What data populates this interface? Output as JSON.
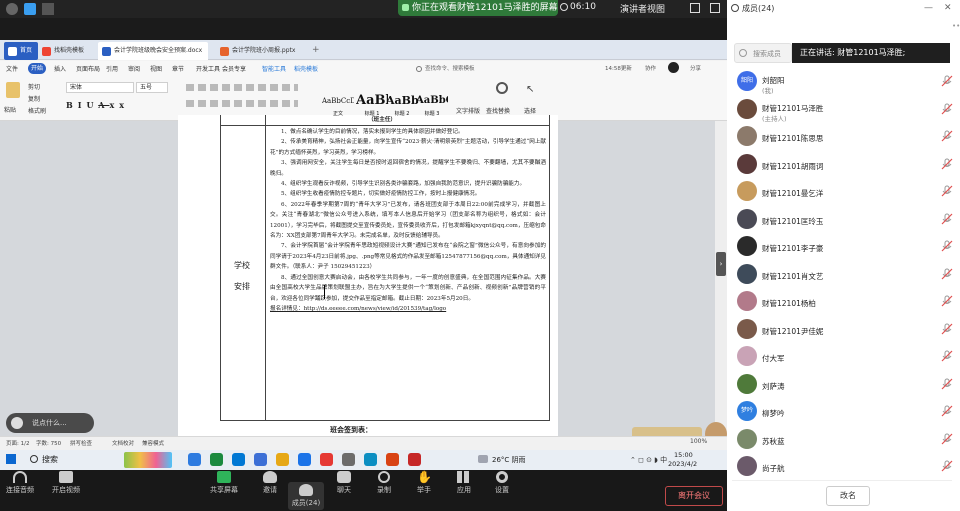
{
  "meeting": {
    "share_banner": "你正在观看财管12101马泽胜的屏幕",
    "timer": "06:10",
    "view_mode": "演讲者视图",
    "participants_title": "成员(24)",
    "search_placeholder": "搜索成员",
    "speaking_label": "正在讲话: 财管12101马泽胜;",
    "toolbar": {
      "audio": "连接音频",
      "video": "开启视频",
      "share": "共享屏幕",
      "invite": "邀请",
      "members": "成员(24)",
      "chat": "聊天",
      "record": "录制",
      "raise_hand": "举手",
      "apps": "应用",
      "settings": "设置",
      "leave": "离开会议"
    },
    "mute_all": "改名",
    "chat_hint": "说点什么..."
  },
  "members": [
    {
      "name": "刘韶阳",
      "sub": "(我)",
      "avatar_text": "韶阳",
      "color": "#3f6ee8"
    },
    {
      "name": "财管12101马泽胜",
      "sub": "(主持人)",
      "avatar_text": "",
      "color": "#6a4b3c"
    },
    {
      "name": "财管12101陈思思",
      "sub": "",
      "avatar_text": "",
      "color": "#8c7a6b"
    },
    {
      "name": "财管12101胡雨词",
      "sub": "",
      "avatar_text": "",
      "color": "#5a3a3a"
    },
    {
      "name": "财管12101曼乞洋",
      "sub": "",
      "avatar_text": "",
      "color": "#c79b5d"
    },
    {
      "name": "财管12101匡玲玉",
      "sub": "",
      "avatar_text": "",
      "color": "#4a4a55"
    },
    {
      "name": "财管12101李子豪",
      "sub": "",
      "avatar_text": "",
      "color": "#2a2a2a"
    },
    {
      "name": "财管12101肖文艺",
      "sub": "",
      "avatar_text": "",
      "color": "#3e4b5a"
    },
    {
      "name": "财管12101杨柏",
      "sub": "",
      "avatar_text": "",
      "color": "#b27a8a"
    },
    {
      "name": "财管12101尹佳妮",
      "sub": "",
      "avatar_text": "",
      "color": "#7a5a4a"
    },
    {
      "name": "付大军",
      "sub": "",
      "avatar_text": "",
      "color": "#c9a3b6"
    },
    {
      "name": "刘萨涛",
      "sub": "",
      "avatar_text": "",
      "color": "#4f7a3a"
    },
    {
      "name": "柳梦吟",
      "sub": "",
      "avatar_text": "梦吟",
      "color": "#2f7fe0"
    },
    {
      "name": "苏秋蓝",
      "sub": "",
      "avatar_text": "",
      "color": "#7a8a6a"
    },
    {
      "name": "尚子航",
      "sub": "",
      "avatar_text": "",
      "color": "#6b5a6a"
    }
  ],
  "wps": {
    "tabs": [
      "首页",
      "找稻壳模板",
      "会计学院班级晚会安全预案.docx",
      "会计学院班小周报.pptx"
    ],
    "menus": [
      "文件",
      "开始",
      "插入",
      "页面布局",
      "引用",
      "审阅",
      "视图",
      "章节",
      "开发工具",
      "会员专享",
      "智能工具",
      "稻壳模板"
    ],
    "search_hint": "查找命令、搜索模板",
    "right_actions": [
      "14:58更新",
      "协作",
      "分享"
    ],
    "ribbon": {
      "paste": "粘贴",
      "cut": "剪切",
      "copy": "复制",
      "format_painter": "格式刷",
      "font_name": "宋体",
      "font_size": "五号",
      "styles": [
        {
          "sample": "AaBbCcDc",
          "name": "正文"
        },
        {
          "sample": "AaBb",
          "name": "标题 1"
        },
        {
          "sample": "AaBbC",
          "name": "标题 2"
        },
        {
          "sample": "AaBbC",
          "name": "标题 3"
        }
      ],
      "find": "查找替换",
      "text_tools": "文字排版",
      "select": "选择"
    },
    "status": [
      "页面: 1/2",
      "字数: 750",
      "拼写检查",
      "文档校对",
      "兼容模式"
    ],
    "zoom": "100%"
  },
  "document": {
    "header_right": "（班主任）",
    "left_label_1": "学校",
    "left_label_2": "安排",
    "paragraphs": [
      "1、做点名确认学生的目前情况，落实未报到学生的具体原因并做好登记。",
      "2、传承美育精神，弘扬社会正能量，向学生宣传“2023·薪火·清明祭英烈”主题活动，引导学生通过“网上献花”的方式缅怀英烈，学习英烈，学习榜样。",
      "3、强调用网安全，关注学生每日是否按时返回宿舍的情况，提醒学生不要晚归、不要翻墙，尤其不要酗酒晚归。",
      "4、组织学生观看反诈视频，引导学生识别各类诈骗套路，加强自我防范意识，提升识骗防骗能力。",
      "5、组织学生收看疫情防控专题片，切实做好疫情防控工作，按时上报健康情况。",
      "6、2022年春季学期第7周的“青年大学习”已发布，请各班团支部于本周日22:00前完成学习，并截图上交。关注“青春湖北”微信公众号进入系统，填写本人信息后开始学习（团支部名称为组织号，格式如：会计12001），学习完毕后，将截图提交至宣传委员处，宣传委员收齐后，打包发邮箱kjxyqnt@qq.com，压缩包命名为：XX团支部第7周青年大学习。未完成名单，及时反馈给辅导员。",
      "7、会计学院首届“会计学院青年思政短视频设计大赛”通知已发布在“会院之窗”微信公众号，有意向参加的同学请于2023年4月23日前将.jpg、.png等常见格式的作品发至邮箱12547877156@qq.com，具体通知详见群文件。（联系人：尹子 15029451223）",
      "8、通过全国创意大赛启动会，由各校学生共同参与，一年一度的创意盛典，在全国范围内征集作品。大赛由全国高校大学生品牌策划联盟主办，旨在为大学生提供一个“策划创新、产品创新、视频创新”品牌营销的平台，欢迎各位同学踊跃参加，提交作品至指定邮箱。截止日期：2023年5月20日。",
      "报名详情见：http://ds.eeeee.com/news/view/id/201539/tag/logo"
    ],
    "footer_title": "班会签到表："
  },
  "taskbar": {
    "search": "搜索",
    "weather": "26°C 阴雨",
    "time": "15:00",
    "date": "2023/4/2"
  }
}
